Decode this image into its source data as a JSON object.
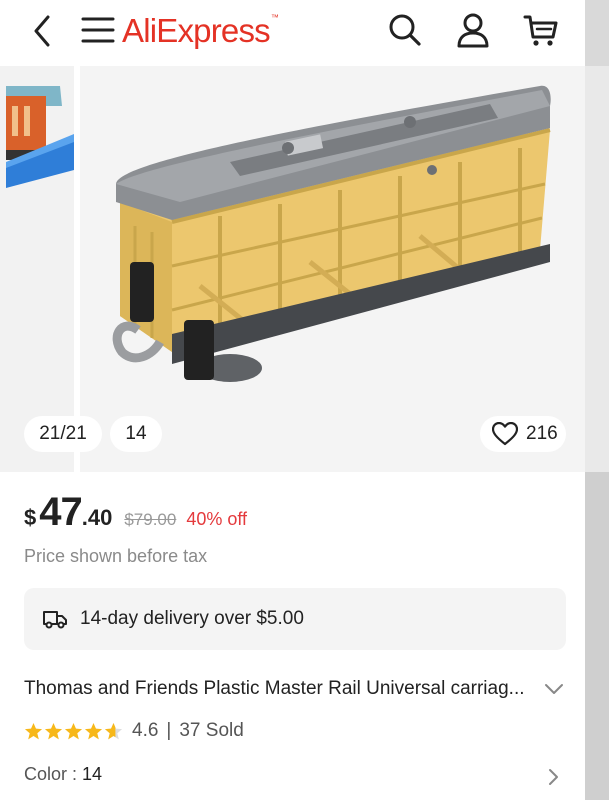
{
  "header": {
    "logo_text": "AliExpress",
    "logo_mark": "™",
    "brand_color": "#e43225",
    "icons": [
      "back-icon",
      "menu-icon",
      "search-icon",
      "account-icon",
      "cart-icon"
    ]
  },
  "gallery": {
    "counter": "21/21",
    "variant_pill": "14",
    "wishlist_count": "216",
    "product_image": "yellow cattle wagon toy with grey roof"
  },
  "product": {
    "currency": "$",
    "price_int": "47",
    "price_dec": ".40",
    "original_price": "$79.00",
    "discount": "40% off",
    "discount_color": "#e4393c",
    "tax_note": "Price shown before tax",
    "delivery": "14-day delivery over $5.00",
    "title": "Thomas and Friends Plastic Master Rail Universal carriag...",
    "rating": "4.6",
    "sold": "37 Sold",
    "rating_separator": "|",
    "rating_stars": 4.6,
    "star_color": "#f7b81a",
    "color_label": "Color : ",
    "color_value": "14"
  }
}
